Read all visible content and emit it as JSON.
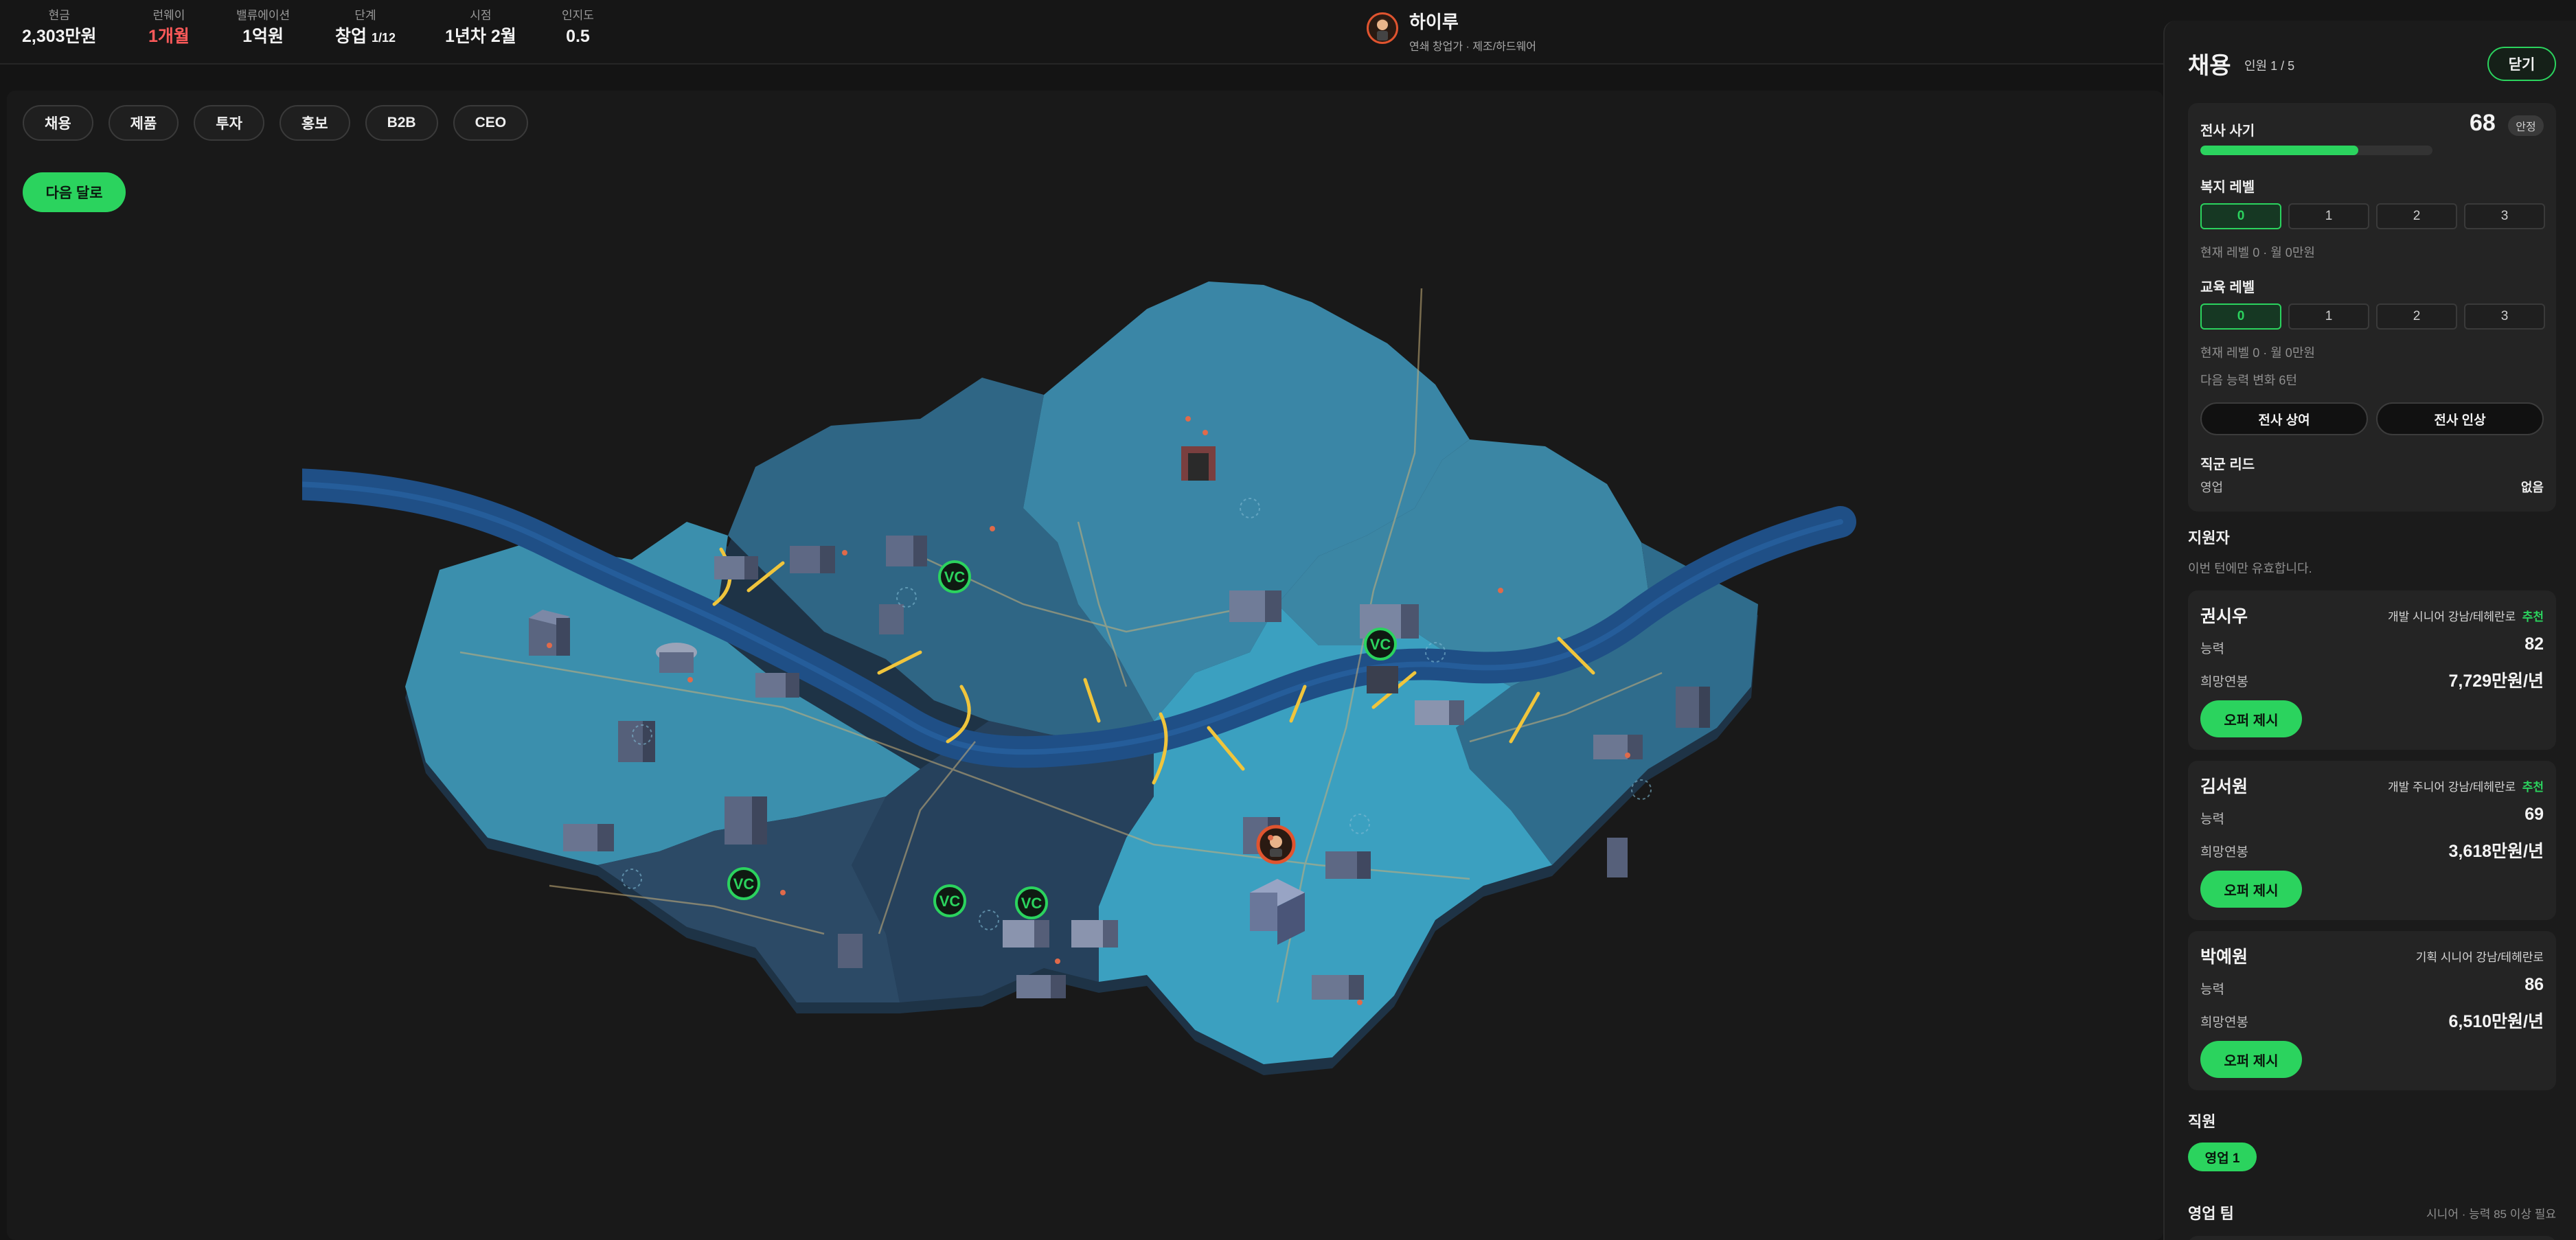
{
  "topbar": {
    "stats": [
      {
        "label": "현금",
        "value": "2,303만원"
      },
      {
        "label": "런웨이",
        "value": "1개월"
      },
      {
        "label": "밸류에이션",
        "value": "1억원"
      },
      {
        "label": "단계",
        "value": "창업",
        "extra": "1/12"
      },
      {
        "label": "시점",
        "value": "1년차 2월"
      },
      {
        "label": "인지도",
        "value": "0.5"
      }
    ],
    "character": {
      "name": "하이루",
      "subtitle": "연쇄 창업가 · 제조/하드웨어"
    }
  },
  "toolbar": {
    "chips": [
      "채용",
      "제품",
      "투자",
      "홍보",
      "B2B",
      "CEO"
    ],
    "next_label": "다음 달로"
  },
  "map": {
    "vc_label": "VC",
    "vc_count": 5,
    "colors": {
      "river": "#1f4f86",
      "district_light": "#3e96b3",
      "district_mid": "#336e8e",
      "district_dark": "#2a4460",
      "vc_green": "#2bd35e"
    }
  },
  "panel": {
    "title": "채용",
    "staff": "인원 1 / 5",
    "close_label": "닫기",
    "morale": {
      "label": "전사 사기",
      "value": "68",
      "tag": "안정",
      "level_percent": 68
    },
    "welfare": {
      "label": "복지 레벨",
      "options": [
        "0",
        "1",
        "2",
        "3"
      ],
      "selected": "0",
      "note": "현재 레벨 0 · 월 0만원"
    },
    "education": {
      "label": "교육 레벨",
      "options": [
        "0",
        "1",
        "2",
        "3"
      ],
      "selected": "0",
      "note": "현재 레벨 0 · 월 0만원",
      "note2": "다음 능력 변화 6턴"
    },
    "actions": {
      "bonus": "전사 상여",
      "raise": "전사 인상"
    },
    "lead": {
      "label": "직군 리드",
      "role": "영업",
      "value": "없음"
    },
    "applicants": {
      "title": "지원자",
      "note": "이번 턴에만 유효합니다.",
      "ability_label": "능력",
      "salary_label": "희망연봉",
      "offer_label": "오퍼 제시",
      "list": [
        {
          "name": "권시우",
          "tags": "개발  시니어  강남/테헤란로",
          "rec": "추천",
          "ability": "82",
          "salary": "7,729만원/년"
        },
        {
          "name": "김서원",
          "tags": "개발  주니어  강남/테헤란로",
          "rec": "추천",
          "ability": "69",
          "salary": "3,618만원/년"
        },
        {
          "name": "박예원",
          "tags": "기획  시니어  강남/테헤란로",
          "rec": "",
          "ability": "86",
          "salary": "6,510만원/년"
        }
      ]
    },
    "employees": {
      "title": "직원",
      "chip": "영업  1"
    },
    "team": {
      "title": "영업 팀",
      "note": "시니어 · 능력 85 이상 필요"
    }
  }
}
